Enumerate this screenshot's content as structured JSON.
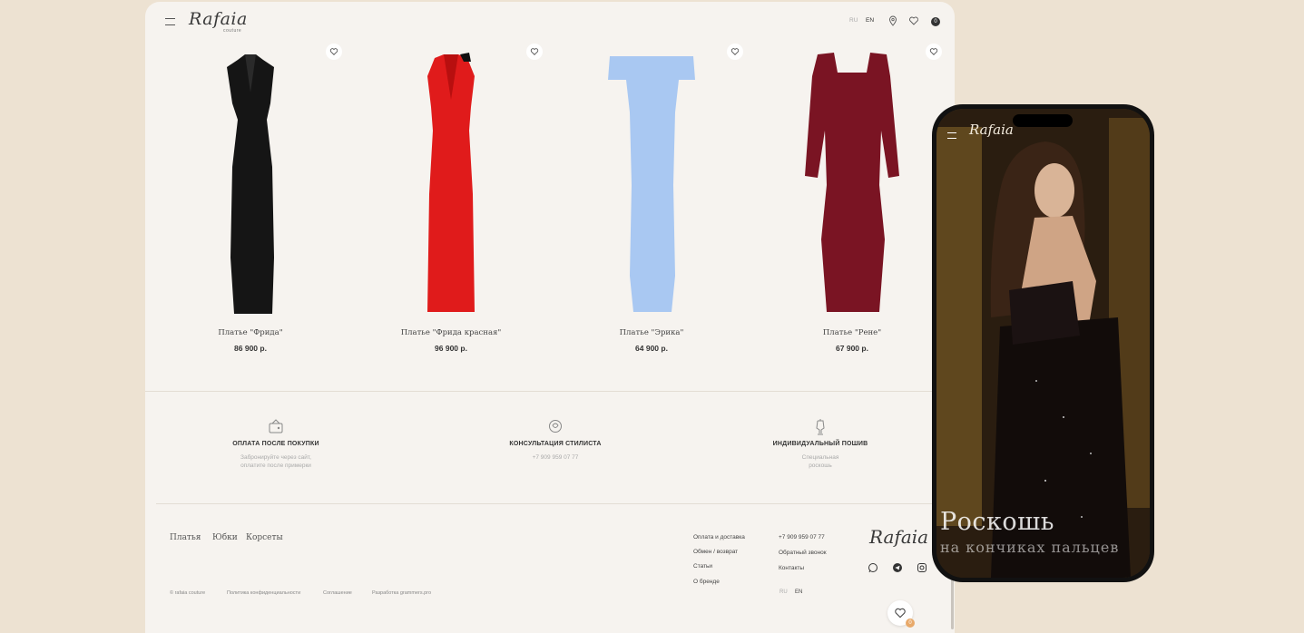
{
  "header": {
    "logo": "Rafaia",
    "logo_sub": "couture",
    "lang_ru": "RU",
    "lang_en": "EN",
    "cart_count": "0",
    "icons": [
      "menu-icon",
      "location-icon",
      "heart-icon",
      "cart-icon"
    ]
  },
  "products": [
    {
      "name": "Платье \"Фрида\"",
      "price": "86 900 р.",
      "color": "#151515"
    },
    {
      "name": "Платье \"Фрида красная\"",
      "price": "96 900 р.",
      "color": "#e01b1b"
    },
    {
      "name": "Платье \"Эрика\"",
      "price": "64 900 р.",
      "color": "#a9c8f2"
    },
    {
      "name": "Платье \"Рене\"",
      "price": "67 900 р.",
      "color": "#7a1423"
    }
  ],
  "features": [
    {
      "title": "ОПЛАТА ПОСЛЕ ПОКУПКИ",
      "sub": "Забронируйте через сайт,\nоплатите после примерки",
      "icon": "wallet-icon"
    },
    {
      "title": "КОНСУЛЬТАЦИЯ СТИЛИСТА",
      "sub": "+7 909 959 07 77",
      "icon": "stylist-icon"
    },
    {
      "title": "ИНДИВИДУАЛЬНЫЙ ПОШИВ",
      "sub": "Специальная\nроскошь",
      "icon": "mannequin-icon"
    }
  ],
  "footer": {
    "nav": [
      "Платья",
      "Юбки",
      "Корсеты"
    ],
    "links_col1": [
      "Оплата и доставка",
      "Обмен / возврат",
      "Статьи",
      "О бренде"
    ],
    "links_col2": [
      "+7 909 959 07 77",
      "Обратный звонок",
      "Контакты"
    ],
    "small": [
      "© rafaia couture",
      "Политика конфиденциальности",
      "Соглашение",
      "Разработка grammers.pro"
    ],
    "lang_ru": "RU",
    "lang_en": "EN",
    "logo": "Rafaia",
    "logo_sub": "couture",
    "fav_count": "0",
    "social_icons": [
      "whatsapp-icon",
      "telegram-icon",
      "instagram-icon"
    ]
  },
  "phone": {
    "logo": "Rafaia",
    "headline": "Роскошь",
    "subline": "на кончиках пальцев"
  }
}
